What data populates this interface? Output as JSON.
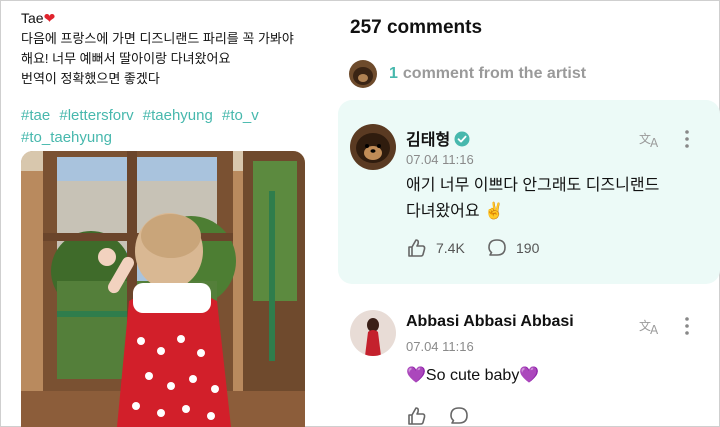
{
  "post": {
    "author": "Tae",
    "body": "다음에 프랑스에 가면 디즈니랜드 파리를 꼭 가봐야\n해요! 너무 예뻐서 딸아이랑 다녀왔어요\n번역이 정확했으면 좋겠다",
    "hashtags": [
      "#tae",
      "#lettersforv",
      "#taehyung",
      "#to_v",
      "#to_taehyung"
    ]
  },
  "comments": {
    "title": "257 comments",
    "artist_count": "1",
    "artist_label": "comment from the artist",
    "items": [
      {
        "name": "김태형",
        "time": "07.04 11:16",
        "text": "애기 너무 이쁘다 안그래도 디즈니랜드\n다녀왔어요",
        "emoji": "✌️",
        "likes": "7.4K",
        "replies": "190"
      },
      {
        "name": "Abbasi Abbasi Abbasi",
        "time": "07.04 11:16",
        "emoji_before": "💜",
        "text": "So cute baby",
        "emoji_after": "💜"
      }
    ]
  },
  "colors": {
    "accent": "#47b8ad",
    "card_bg": "#ecfaf7",
    "heart": "#e0242e"
  }
}
